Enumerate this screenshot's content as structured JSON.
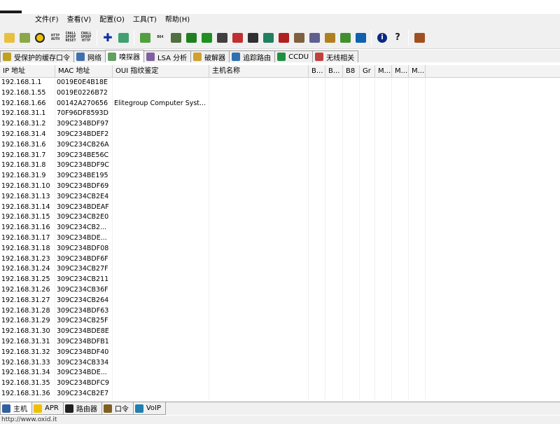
{
  "menu": [
    "文件(F)",
    "查看(V)",
    "配置(O)",
    "工具(T)",
    "帮助(H)"
  ],
  "toolbar": {
    "icons": [
      {
        "name": "open-icon",
        "color": "#e8c040"
      },
      {
        "name": "network-icon",
        "color": "#8aa84a"
      },
      {
        "name": "radiation-icon",
        "color": "#f0c000"
      },
      {
        "name": "http-auth-icon",
        "text": "HTTP AUTH"
      },
      {
        "name": "chall-spoof-reset-icon",
        "text": "CHALL SPOOF RESET"
      },
      {
        "name": "chall-spoof-http-icon",
        "text": "CHALL SPOOF HTTP"
      },
      {
        "name": "add-icon",
        "color": "#1030a0"
      },
      {
        "name": "sniffer-icon",
        "color": "#40a070"
      },
      {
        "name": "scan-icon",
        "color": "#50a040"
      },
      {
        "name": "base64-icon",
        "text": "B64"
      },
      {
        "name": "decoder-icon",
        "color": "#507040"
      },
      {
        "name": "hash-calc-icon",
        "color": "#208020"
      },
      {
        "name": "voip-icon",
        "color": "#209020"
      },
      {
        "name": "route-icon",
        "color": "#404040"
      },
      {
        "name": "dictionary-icon",
        "color": "#c03030"
      },
      {
        "name": "password-icon",
        "color": "#303030"
      },
      {
        "name": "monitor-icon",
        "color": "#208060"
      },
      {
        "name": "disk-icon",
        "color": "#b02020"
      },
      {
        "name": "users-icon",
        "color": "#806040"
      },
      {
        "name": "keys-icon",
        "color": "#606090"
      },
      {
        "name": "cd-icon",
        "color": "#b08020"
      },
      {
        "name": "book-icon",
        "color": "#409030"
      },
      {
        "name": "wireless-icon",
        "color": "#1060b0"
      },
      {
        "name": "info-icon",
        "color": "#0a2a80"
      },
      {
        "name": "help-icon",
        "color": "#202020"
      },
      {
        "name": "exit-icon",
        "color": "#a05020"
      }
    ]
  },
  "tabs": [
    {
      "name": "tab-cached-passwords",
      "label": "受保护的缓存口令",
      "icon": "key-icon",
      "color": "#c0a020"
    },
    {
      "name": "tab-network",
      "label": "网络",
      "icon": "network-icon",
      "color": "#4070b0"
    },
    {
      "name": "tab-sniffer",
      "label": "嗅探器",
      "icon": "sniffer-icon",
      "color": "#60a060",
      "active": true
    },
    {
      "name": "tab-lsa",
      "label": "LSA 分析",
      "icon": "lsa-icon",
      "color": "#8060a0"
    },
    {
      "name": "tab-cracker",
      "label": "破解器",
      "icon": "cracker-icon",
      "color": "#d0a030"
    },
    {
      "name": "tab-traceroute",
      "label": "追踪路由",
      "icon": "traceroute-icon",
      "color": "#3070b0"
    },
    {
      "name": "tab-ccdu",
      "label": "CCDU",
      "icon": "ccdu-icon",
      "color": "#209040"
    },
    {
      "name": "tab-wireless",
      "label": "无线相关",
      "icon": "wireless-icon",
      "color": "#c04040"
    }
  ],
  "grid": {
    "headers": [
      "IP 地址",
      "MAC 地址",
      "OUI 指纹鉴定",
      "主机名称",
      "B...",
      "B...",
      "B8",
      "Gr",
      "M...",
      "M...",
      "M..."
    ],
    "rows": [
      [
        "192.168.1.1",
        "0019E0E4B18E",
        ""
      ],
      [
        "192.168.1.55",
        "0019E0226B72",
        ""
      ],
      [
        "192.168.1.66",
        "00142A270656",
        "Elitegroup Computer Syst..."
      ],
      [
        "192.168.31.1",
        "70F96DF8593D",
        ""
      ],
      [
        "192.168.31.2",
        "309C234BDF97",
        ""
      ],
      [
        "192.168.31.4",
        "309C234BDEF2",
        ""
      ],
      [
        "192.168.31.6",
        "309C234CB26A",
        ""
      ],
      [
        "192.168.31.7",
        "309C234BE56C",
        ""
      ],
      [
        "192.168.31.8",
        "309C234BDF9C",
        ""
      ],
      [
        "192.168.31.9",
        "309C234BE195",
        ""
      ],
      [
        "192.168.31.10",
        "309C234BDF69",
        ""
      ],
      [
        "192.168.31.13",
        "309C234CB2E4",
        ""
      ],
      [
        "192.168.31.14",
        "309C234BDEAF",
        ""
      ],
      [
        "192.168.31.15",
        "309C234CB2E0",
        ""
      ],
      [
        "192.168.31.16",
        "309C234CB2...",
        ""
      ],
      [
        "192.168.31.17",
        "309C234BDE...",
        ""
      ],
      [
        "192.168.31.18",
        "309C234BDF08",
        ""
      ],
      [
        "192.168.31.23",
        "309C234BDF6F",
        ""
      ],
      [
        "192.168.31.24",
        "309C234CB27F",
        ""
      ],
      [
        "192.168.31.25",
        "309C234CB211",
        ""
      ],
      [
        "192.168.31.26",
        "309C234CB36F",
        ""
      ],
      [
        "192.168.31.27",
        "309C234CB264",
        ""
      ],
      [
        "192.168.31.28",
        "309C234BDF63",
        ""
      ],
      [
        "192.168.31.29",
        "309C234CB25F",
        ""
      ],
      [
        "192.168.31.30",
        "309C234BDE8E",
        ""
      ],
      [
        "192.168.31.31",
        "309C234BDFB1",
        ""
      ],
      [
        "192.168.31.32",
        "309C234BDF40",
        ""
      ],
      [
        "192.168.31.33",
        "309C234CB334",
        ""
      ],
      [
        "192.168.31.34",
        "309C234BDE...",
        ""
      ],
      [
        "192.168.31.35",
        "309C234BDFC9",
        ""
      ],
      [
        "192.168.31.36",
        "309C234CB2E7",
        ""
      ]
    ]
  },
  "bottom_tabs": [
    {
      "name": "btab-hosts",
      "label": "主机",
      "icon": "monitor-icon",
      "color": "#3060a0",
      "active": true
    },
    {
      "name": "btab-apr",
      "label": "APR",
      "icon": "radiation-icon",
      "color": "#f0c000"
    },
    {
      "name": "btab-routing",
      "label": "路由器",
      "icon": "router-icon",
      "color": "#202020"
    },
    {
      "name": "btab-passwords",
      "label": "口令",
      "icon": "password-icon",
      "color": "#806020"
    },
    {
      "name": "btab-voip",
      "label": "VoIP",
      "icon": "voip-icon",
      "color": "#2080b0"
    }
  ],
  "status": "http://www.oxid.it"
}
